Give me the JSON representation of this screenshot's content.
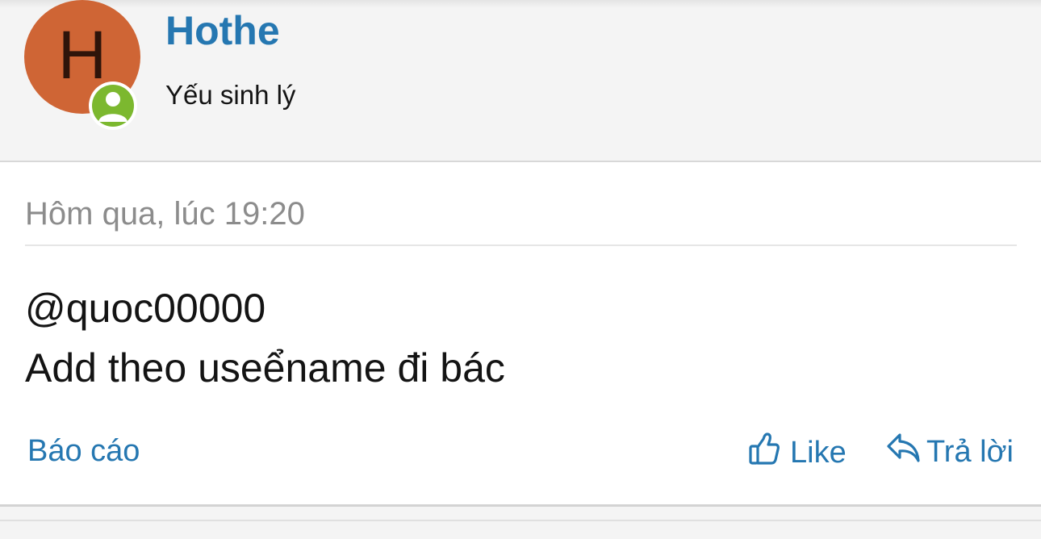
{
  "post": {
    "author": {
      "avatar_letter": "H",
      "avatar_color": "#cf6535",
      "online_badge_color": "#7cb82f",
      "username": "Hothe",
      "user_title": "Yếu sinh lý"
    },
    "timestamp": "Hôm qua, lúc 19:20",
    "message": {
      "mention": "@quoc00000",
      "body": "Add theo useểname đi bác"
    },
    "actions": {
      "report_label": "Báo cáo",
      "like_label": "Like",
      "like_icon": "thumbs-up-icon",
      "reply_label": "Trả lời",
      "reply_icon": "reply-arrow-icon"
    }
  },
  "colors": {
    "link": "#2577b1",
    "page_background": "#f4f4f4",
    "card_background": "#ffffff"
  }
}
